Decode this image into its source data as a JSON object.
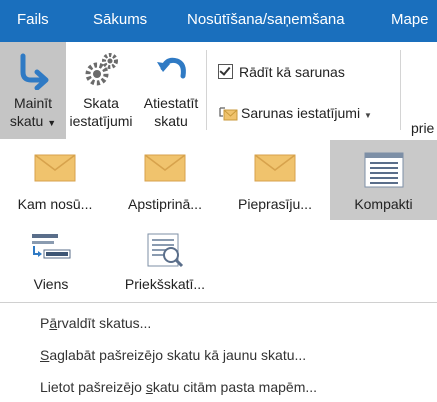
{
  "tabs": [
    "Fails",
    "Sākums",
    "Nosūtīšana/saņemšana",
    "Mape"
  ],
  "ribbon": {
    "change_view": {
      "line1": "Mainīt",
      "line2": "skatu"
    },
    "view_settings": {
      "line1": "Skata",
      "line2": "iestatījumi"
    },
    "reset_view": {
      "line1": "Atiestatīt",
      "line2": "skatu"
    },
    "show_as_conversations": "Rādīt kā sarunas",
    "conversation_settings": "Sarunas iestatījumi",
    "overflow_partial": "prie"
  },
  "gallery": {
    "items": [
      {
        "label": "Kam nosū...",
        "icon": "envelope-icon"
      },
      {
        "label": "Apstiprinā...",
        "icon": "envelope-icon"
      },
      {
        "label": "Pieprasīju...",
        "icon": "envelope-icon"
      },
      {
        "label": "Kompakti",
        "icon": "compact-view-icon",
        "selected": true
      },
      {
        "label": "Viens",
        "icon": "single-view-icon"
      },
      {
        "label": "Priekšskatī...",
        "icon": "preview-view-icon"
      }
    ]
  },
  "menu": {
    "manage_a": "P",
    "manage_key": "ā",
    "manage_b": "rvaldīt skatus...",
    "save_key": "S",
    "save_rest": "aglabāt pašreizējo skatu kā jaunu skatu...",
    "apply_a": "Lietot pašreizējo ",
    "apply_key": "s",
    "apply_b": "katu citām pasta mapēm..."
  },
  "colors": {
    "accent": "#1a6fbd",
    "envelope": "#f0c36d",
    "selected": "#c9c9c9"
  }
}
